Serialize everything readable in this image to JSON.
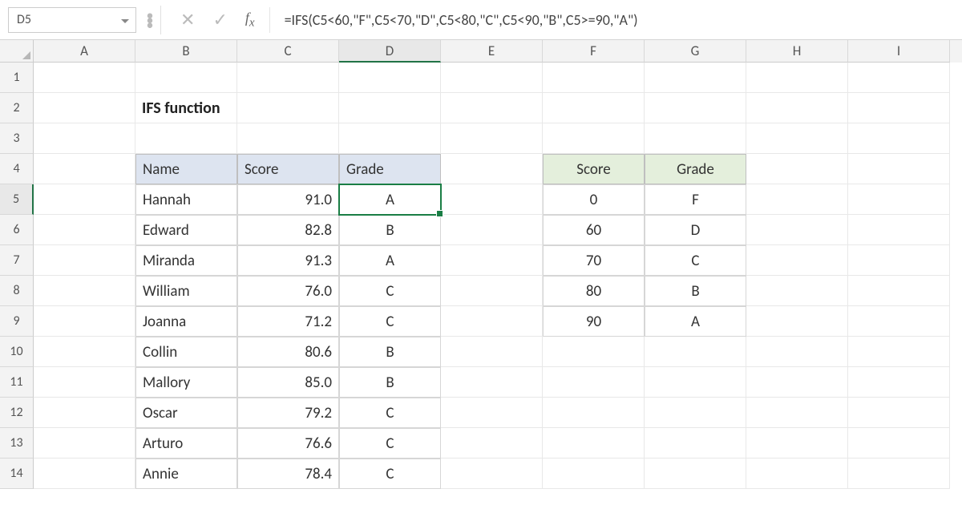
{
  "name_box": "D5",
  "formula": "=IFS(C5<60,\"F\",C5<70,\"D\",C5<80,\"C\",C5<90,\"B\",C5>=90,\"A\")",
  "columns": [
    "A",
    "B",
    "C",
    "D",
    "E",
    "F",
    "G",
    "H",
    "I"
  ],
  "selected_col_index": 3,
  "selected_row": 5,
  "row_count": 14,
  "title": "IFS function",
  "main_headers": {
    "name": "Name",
    "score": "Score",
    "grade": "Grade"
  },
  "main_rows": [
    {
      "name": "Hannah",
      "score": "91.0",
      "grade": "A"
    },
    {
      "name": "Edward",
      "score": "82.8",
      "grade": "B"
    },
    {
      "name": "Miranda",
      "score": "91.3",
      "grade": "A"
    },
    {
      "name": "William",
      "score": "76.0",
      "grade": "C"
    },
    {
      "name": "Joanna",
      "score": "71.2",
      "grade": "C"
    },
    {
      "name": "Collin",
      "score": "80.6",
      "grade": "B"
    },
    {
      "name": "Mallory",
      "score": "85.0",
      "grade": "B"
    },
    {
      "name": "Oscar",
      "score": "79.2",
      "grade": "C"
    },
    {
      "name": "Arturo",
      "score": "76.6",
      "grade": "C"
    },
    {
      "name": "Annie",
      "score": "78.4",
      "grade": "C"
    }
  ],
  "key_headers": {
    "score": "Score",
    "grade": "Grade"
  },
  "key_rows": [
    {
      "score": "0",
      "grade": "F"
    },
    {
      "score": "60",
      "grade": "D"
    },
    {
      "score": "70",
      "grade": "C"
    },
    {
      "score": "80",
      "grade": "B"
    },
    {
      "score": "90",
      "grade": "A"
    }
  ],
  "chart_data": {
    "type": "table",
    "title": "IFS function",
    "tables": [
      {
        "headers": [
          "Name",
          "Score",
          "Grade"
        ],
        "rows": [
          [
            "Hannah",
            91.0,
            "A"
          ],
          [
            "Edward",
            82.8,
            "B"
          ],
          [
            "Miranda",
            91.3,
            "A"
          ],
          [
            "William",
            76.0,
            "C"
          ],
          [
            "Joanna",
            71.2,
            "C"
          ],
          [
            "Collin",
            80.6,
            "B"
          ],
          [
            "Mallory",
            85.0,
            "B"
          ],
          [
            "Oscar",
            79.2,
            "C"
          ],
          [
            "Arturo",
            76.6,
            "C"
          ],
          [
            "Annie",
            78.4,
            "C"
          ]
        ]
      },
      {
        "headers": [
          "Score",
          "Grade"
        ],
        "rows": [
          [
            0,
            "F"
          ],
          [
            60,
            "D"
          ],
          [
            70,
            "C"
          ],
          [
            80,
            "B"
          ],
          [
            90,
            "A"
          ]
        ]
      }
    ]
  }
}
